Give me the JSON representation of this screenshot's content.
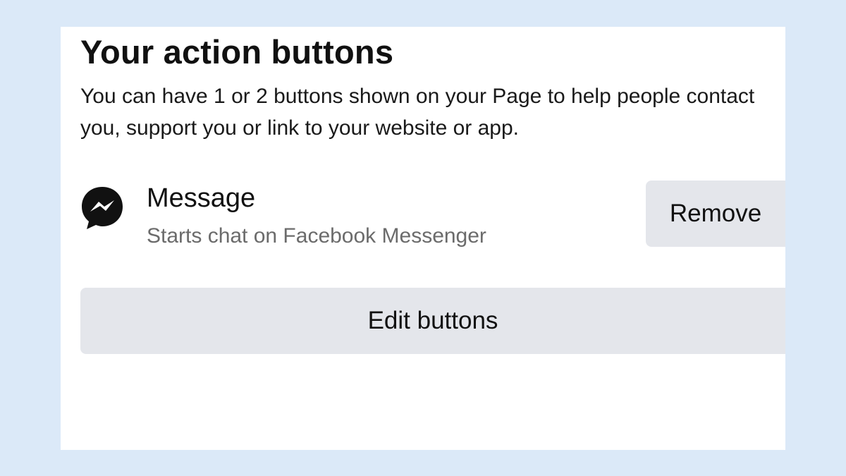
{
  "section": {
    "title": "Your action buttons",
    "description": "You can have 1 or 2 buttons shown on your Page to help people contact you, support you or link to your website or app."
  },
  "action_item": {
    "icon": "messenger-icon",
    "name": "Message",
    "subtitle": "Starts chat on Facebook Messenger",
    "remove_label": "Remove"
  },
  "edit_buttons_label": "Edit buttons",
  "colors": {
    "background": "#dbe9f8",
    "panel": "#ffffff",
    "button_bg": "#e4e6eb",
    "text_primary": "#111111",
    "text_secondary": "#6b6b6b"
  }
}
